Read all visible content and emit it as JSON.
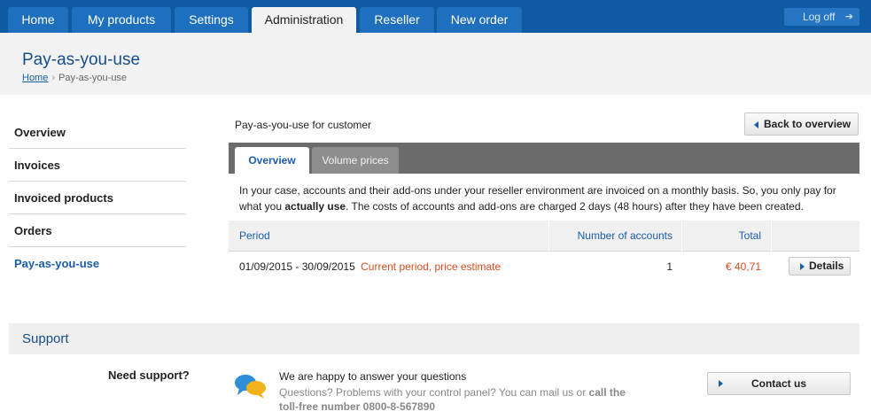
{
  "nav": {
    "tabs": [
      {
        "label": "Home"
      },
      {
        "label": "My products"
      },
      {
        "label": "Settings"
      },
      {
        "label": "Administration"
      },
      {
        "label": "Reseller"
      },
      {
        "label": "New order"
      }
    ],
    "active_tab": "Administration",
    "logoff_label": "Log off",
    "logoff_icon": "arrow-right-icon"
  },
  "header": {
    "title": "Pay-as-you-use",
    "breadcrumb": {
      "home": "Home",
      "sep": "›",
      "current": "Pay-as-you-use"
    }
  },
  "sidebar": {
    "items": [
      {
        "label": "Overview"
      },
      {
        "label": "Invoices"
      },
      {
        "label": "Invoiced products"
      },
      {
        "label": "Orders"
      },
      {
        "label": "Pay-as-you-use"
      }
    ],
    "active": "Pay-as-you-use"
  },
  "main": {
    "subtitle": "Pay-as-you-use for customer",
    "back_button": "Back to overview",
    "tabs": [
      {
        "label": "Overview"
      },
      {
        "label": "Volume prices"
      }
    ],
    "intro_part1": "In your case, accounts and their add-ons under your reseller environment are invoiced on a monthly basis. So, you only pay for what you ",
    "intro_bold": "actually use",
    "intro_part2": ". The costs of accounts and add-ons are charged 2 days (48 hours) after they have been created.",
    "table": {
      "headers": {
        "period": "Period",
        "accounts": "Number of accounts",
        "total": "Total"
      },
      "rows": [
        {
          "period": "01/09/2015 - 30/09/2015",
          "note": "Current period, price estimate",
          "accounts": "1",
          "total": "€ 40,71",
          "action": "Details"
        }
      ]
    }
  },
  "support": {
    "title": "Support",
    "need": "Need support?",
    "happy": "We are happy to answer your questions",
    "questions": "Questions? Problems with your control panel? You can mail us or ",
    "call": "call the toll-free number 0800-8-567890",
    "contact_button": "Contact us"
  },
  "colors": {
    "nav_bg": "#0f5aa3",
    "accent_blue": "#1a5caa",
    "price_red": "#d64c1e"
  }
}
